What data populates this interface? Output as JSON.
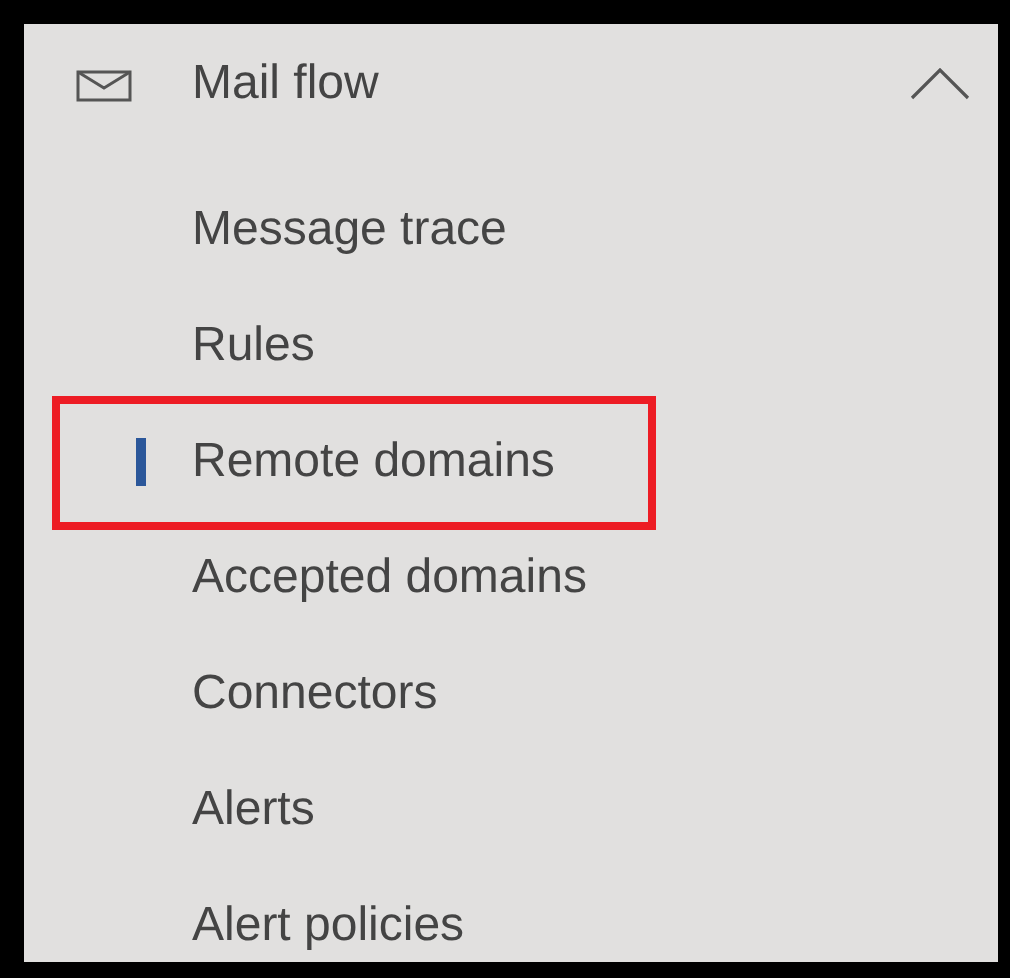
{
  "section": {
    "title": "Mail flow",
    "expanded": true
  },
  "items": [
    {
      "label": "Message trace",
      "selected": false,
      "highlighted": false
    },
    {
      "label": "Rules",
      "selected": false,
      "highlighted": false
    },
    {
      "label": "Remote domains",
      "selected": true,
      "highlighted": true
    },
    {
      "label": "Accepted domains",
      "selected": false,
      "highlighted": false
    },
    {
      "label": "Connectors",
      "selected": false,
      "highlighted": false
    },
    {
      "label": "Alerts",
      "selected": false,
      "highlighted": false
    },
    {
      "label": "Alert policies",
      "selected": false,
      "highlighted": false
    }
  ]
}
